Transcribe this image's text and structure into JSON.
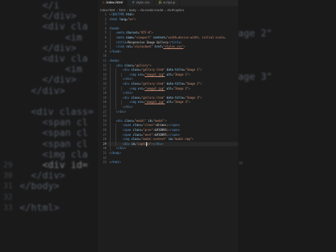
{
  "background": {
    "lines": [
      {
        "num": "",
        "code": "    </i"
      },
      {
        "num": "",
        "code": "    </div>"
      },
      {
        "num": "",
        "code": "    <div cla"
      },
      {
        "num": "",
        "code": "        <im"
      },
      {
        "num": "",
        "code": "    </div>"
      },
      {
        "num": "",
        "code": "    <div cla"
      },
      {
        "num": "",
        "code": "        <im"
      },
      {
        "num": "",
        "code": "    </div>"
      },
      {
        "num": "",
        "code": "  </div>"
      },
      {
        "num": "",
        "code": ""
      },
      {
        "num": "",
        "code": "  <div class="
      },
      {
        "num": "",
        "code": "    <span cl"
      },
      {
        "num": "",
        "code": "    <span cl"
      },
      {
        "num": "",
        "code": "    <span cl"
      },
      {
        "num": "",
        "code": "    <img cla"
      },
      {
        "num": "29",
        "code": "    <div id="
      },
      {
        "num": "30",
        "code": "  </div>"
      },
      {
        "num": "31",
        "code": "</body>"
      },
      {
        "num": "32",
        "code": ""
      },
      {
        "num": "33",
        "code": "</html>"
      }
    ],
    "right_fragments": [
      "age 2\"",
      "age 3\"",
      "\""
    ]
  },
  "editor": {
    "tabs": [
      {
        "label": "index.html",
        "icon": "html-file-icon",
        "active": true
      },
      {
        "label": "style.css",
        "icon": "css-file-icon",
        "active": false
      },
      {
        "label": "script.js",
        "icon": "js-file-icon",
        "active": false
      }
    ],
    "breadcrumbs": [
      "index.html",
      "html",
      "body",
      "div.modal.modal",
      "div#caption"
    ],
    "lines": [
      {
        "num": "1",
        "html": "<span class='t'>&lt;!</span><span class='n'>DOCTYPE</span> <span class='a'>html</span><span class='t'>&gt;</span>"
      },
      {
        "num": "2",
        "html": "<span class='t'>&lt;</span><span class='n'>html</span> <span class='a'>lang</span>=<span class='s'>\"en\"</span><span class='t'>&gt;</span>"
      },
      {
        "num": "3",
        "html": ""
      },
      {
        "num": "4",
        "html": "<span class='t'>&lt;</span><span class='n'>head</span><span class='t'>&gt;</span>"
      },
      {
        "num": "5",
        "html": "    <span class='t'>&lt;</span><span class='n'>meta</span> <span class='a'>charset</span>=<span class='s'>\"UTF-8\"</span><span class='t'>&gt;</span>"
      },
      {
        "num": "6",
        "html": "    <span class='t'>&lt;</span><span class='n'>meta</span> <span class='a'>name</span>=<span class='s'>\"viewport\"</span> <span class='a'>content</span>=<span class='s'>\"width=device-width, initial-scale=</span>"
      },
      {
        "num": "7",
        "html": "    <span class='t'>&lt;</span><span class='n'>title</span><span class='t'>&gt;</span><span class='x'>Responsive Image Gallery</span><span class='t'>&lt;/</span><span class='n'>title</span><span class='t'>&gt;</span>"
      },
      {
        "num": "8",
        "html": "    <span class='t'>&lt;</span><span class='n'>link</span> <span class='a'>rel</span>=<span class='s'>\"stylesheet\"</span> <span class='a'>href</span>=<span class='s u'>\"styles.css\"</span><span class='t'>&gt;</span>"
      },
      {
        "num": "9",
        "html": "<span class='t'>&lt;/</span><span class='n'>head</span><span class='t'>&gt;</span>"
      },
      {
        "num": "10",
        "html": ""
      },
      {
        "num": "11",
        "html": "<span class='t'>&lt;</span><span class='n'>body</span><span class='t'>&gt;</span>"
      },
      {
        "num": "12",
        "html": "    <span class='t'>&lt;</span><span class='n'>div</span> <span class='a'>class</span>=<span class='s'>\"gallery\"</span><span class='t'>&gt;</span>"
      },
      {
        "num": "13",
        "html": "        <span class='t'>&lt;</span><span class='n'>div</span> <span class='a'>class</span>=<span class='s'>\"gallery-item\"</span> <span class='a'>data-title</span>=<span class='s'>\"Image 1\"</span><span class='t'>&gt;</span>"
      },
      {
        "num": "14",
        "html": "            <span class='t'>&lt;</span><span class='n'>img</span> <span class='a'>src</span>=<span class='s u'>\"image1.jpg\"</span> <span class='a'>alt</span>=<span class='s'>\"Image 1\"</span><span class='t'>&gt;</span>"
      },
      {
        "num": "15",
        "html": "        <span class='t'>&lt;/</span><span class='n'>div</span><span class='t'>&gt;</span>"
      },
      {
        "num": "16",
        "html": "        <span class='t'>&lt;</span><span class='n'>div</span> <span class='a'>class</span>=<span class='s'>\"gallery-item\"</span> <span class='a'>data-title</span>=<span class='s'>\"Image 2\"</span><span class='t'>&gt;</span>"
      },
      {
        "num": "17",
        "html": "            <span class='t'>&lt;</span><span class='n'>img</span> <span class='a'>src</span>=<span class='s u'>\"image2.jpg\"</span> <span class='a'>alt</span>=<span class='s'>\"Image 2\"</span><span class='t'>&gt;</span>"
      },
      {
        "num": "18",
        "html": "        <span class='t'>&lt;/</span><span class='n'>div</span><span class='t'>&gt;</span>"
      },
      {
        "num": "19",
        "html": "        <span class='t'>&lt;</span><span class='n'>div</span> <span class='a'>class</span>=<span class='s'>\"gallery-item\"</span> <span class='a'>data-title</span>=<span class='s'>\"Image 3\"</span><span class='t'>&gt;</span>"
      },
      {
        "num": "20",
        "html": "            <span class='t'>&lt;</span><span class='n'>img</span> <span class='a'>src</span>=<span class='s u'>\"image3.jpg\"</span> <span class='a'>alt</span>=<span class='s'>\"Image 3\"</span><span class='t'>&gt;</span>"
      },
      {
        "num": "21",
        "html": "        <span class='t'>&lt;/</span><span class='n'>div</span><span class='t'>&gt;</span>"
      },
      {
        "num": "22",
        "html": "    <span class='t'>&lt;/</span><span class='n'>div</span><span class='t'>&gt;</span>"
      },
      {
        "num": "23",
        "html": ""
      },
      {
        "num": "24",
        "html": "    <span class='t'>&lt;</span><span class='n'>div</span> <span class='a'>class</span>=<span class='s'>\"modal\"</span> <span class='a'>id</span>=<span class='s'>\"modal\"</span><span class='t'>&gt;</span>"
      },
      {
        "num": "25",
        "html": "        <span class='t'>&lt;</span><span class='n'>span</span> <span class='a'>class</span>=<span class='s'>\"close\"</span><span class='t'>&gt;</span><span class='x'>&amp;times;</span><span class='t'>&lt;/</span><span class='n'>span</span><span class='t'>&gt;</span>"
      },
      {
        "num": "26",
        "html": "        <span class='t'>&lt;</span><span class='n'>span</span> <span class='a'>class</span>=<span class='s'>\"prev\"</span><span class='t'>&gt;</span><span class='x'>&amp;#10094;</span><span class='t'>&lt;/</span><span class='n'>span</span><span class='t'>&gt;</span>"
      },
      {
        "num": "27",
        "html": "        <span class='t'>&lt;</span><span class='n'>span</span> <span class='a'>class</span>=<span class='s'>\"next\"</span><span class='t'>&gt;</span><span class='x'>&amp;#10095;</span><span class='t'>&lt;/</span><span class='n'>span</span><span class='t'>&gt;</span>"
      },
      {
        "num": "28",
        "html": "        <span class='t'>&lt;</span><span class='n'>img</span> <span class='a'>class</span>=<span class='s'>\"modal-content\"</span> <span class='a'>id</span>=<span class='s'>\"modal-img\"</span><span class='t'>&gt;</span>"
      },
      {
        "num": "29",
        "html": "        <span class='t'>&lt;</span><span class='n'>div</span> <span class='a'>id</span>=<span class='s'>\"caption\"</span><span class='t'>&gt;&lt;/</span><span class='n'>div</span><span class='t'>&gt;</span>"
      },
      {
        "num": "30",
        "html": "    <span class='t'>&lt;/</span><span class='n'>div</span><span class='t'>&gt;</span>"
      },
      {
        "num": "31",
        "html": "<span class='t'>&lt;/</span><span class='n'>body</span><span class='t'>&gt;</span>"
      },
      {
        "num": "32",
        "html": ""
      },
      {
        "num": "33",
        "html": "<span class='t'>&lt;/</span><span class='n'>html</span><span class='t'>&gt;</span>"
      }
    ],
    "current_line": 29
  }
}
